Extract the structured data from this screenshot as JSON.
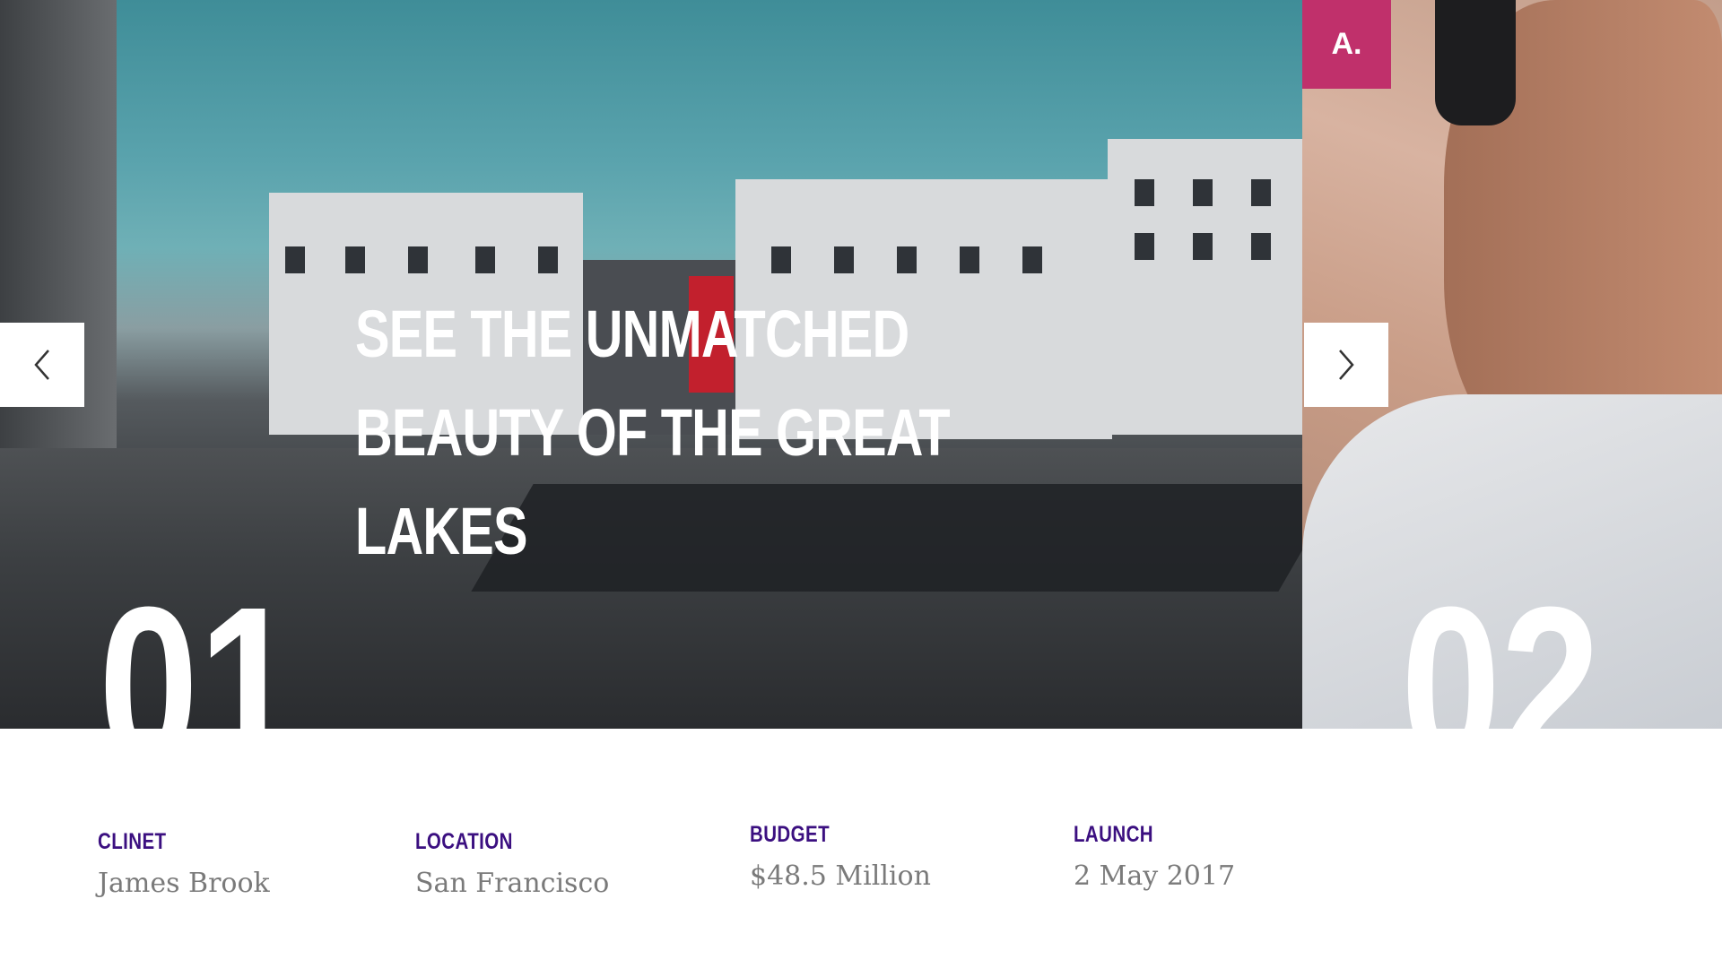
{
  "brand": {
    "logo_text": "A.",
    "accent_color": "#c0306b"
  },
  "slider": {
    "title": "See the unmatched beauty of the great lakes",
    "slides": [
      {
        "number": "01"
      },
      {
        "number": "02"
      }
    ],
    "prev_icon": "chevron-left-icon",
    "next_icon": "chevron-right-icon"
  },
  "details": {
    "label_color": "#3b0f80",
    "items": [
      {
        "label": "Clinet",
        "value": "James Brook"
      },
      {
        "label": "Location",
        "value": "San Francisco"
      },
      {
        "label": "Budget",
        "value": "$48.5 Million"
      },
      {
        "label": "Launch",
        "value": "2 May 2017"
      }
    ]
  }
}
